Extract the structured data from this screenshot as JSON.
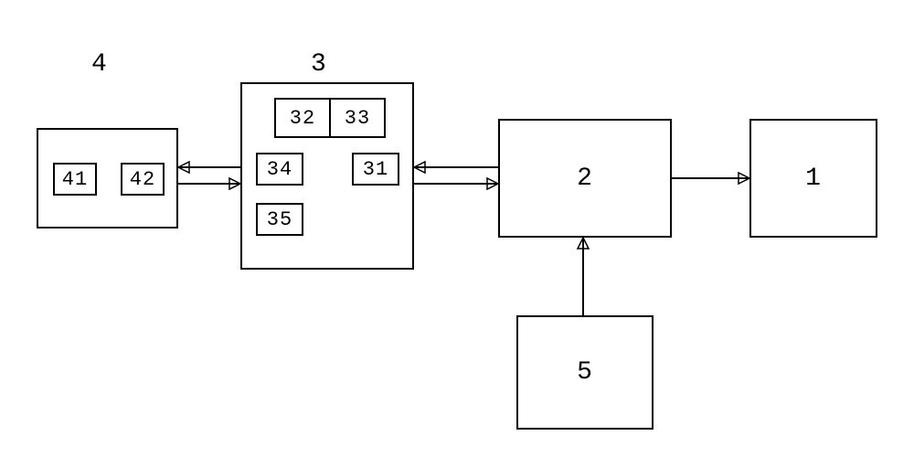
{
  "blocks": {
    "b1": {
      "label": "1"
    },
    "b2": {
      "label": "2"
    },
    "b3": {
      "labelAbove": "3"
    },
    "b4": {
      "labelAbove": "4"
    },
    "b5": {
      "label": "5"
    },
    "i31": {
      "label": "31"
    },
    "i32": {
      "label": "32"
    },
    "i33": {
      "label": "33"
    },
    "i34": {
      "label": "34"
    },
    "i35": {
      "label": "35"
    },
    "i41": {
      "label": "41"
    },
    "i42": {
      "label": "42"
    }
  },
  "chart_data": {
    "type": "diagram",
    "title": "",
    "nodes": [
      {
        "id": "1",
        "contains": []
      },
      {
        "id": "2",
        "contains": []
      },
      {
        "id": "3",
        "contains": [
          "31",
          "32",
          "33",
          "34",
          "35"
        ]
      },
      {
        "id": "4",
        "contains": [
          "41",
          "42"
        ]
      },
      {
        "id": "5",
        "contains": []
      }
    ],
    "edges": [
      {
        "from": "4",
        "to": "3",
        "direction": "bidirectional"
      },
      {
        "from": "3",
        "to": "2",
        "direction": "bidirectional"
      },
      {
        "from": "2",
        "to": "1",
        "direction": "unidirectional"
      },
      {
        "from": "5",
        "to": "2",
        "direction": "unidirectional"
      }
    ]
  }
}
